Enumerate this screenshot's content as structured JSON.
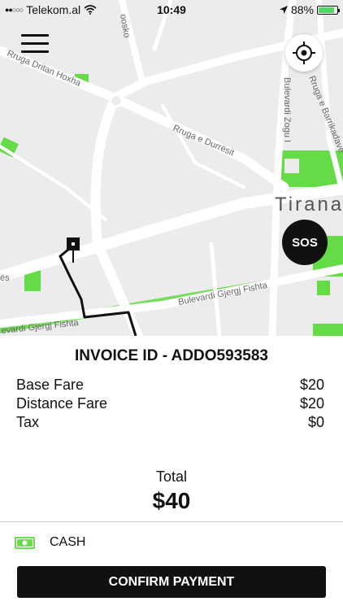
{
  "status_bar": {
    "carrier": "Telekom.al",
    "time": "10:49",
    "battery": "88%",
    "battery_level": 0.88
  },
  "map": {
    "streets": {
      "rruga_dritan_hoxha": "Rruga Dritan Hoxha",
      "rruga_e_durresit": "Rruga e Durrësit",
      "bulevardi_zogu": "Bulevardi Zogu I",
      "rruga_e_barrikadave": "Rruga e Barrikadave",
      "bulevardi_gjergj_fishta": "Bulevardi Gjergj Fishta",
      "bulevardi_gjergj_fishta_left": "evardi Gjergj Fishta",
      "osko": "oosko",
      "es": "ës"
    },
    "city": "Tirana",
    "sos_label": "SOS",
    "colors": {
      "route": "#111111",
      "park": "#64db47",
      "road": "#ffffff"
    }
  },
  "invoice": {
    "title": "INVOICE ID - ADDO593583",
    "fares": [
      {
        "label": "Base Fare",
        "amount": "$20"
      },
      {
        "label": "Distance Fare",
        "amount": "$20"
      },
      {
        "label": "Tax",
        "amount": "$0"
      }
    ],
    "total_label": "Total",
    "total_value": "$40"
  },
  "payment": {
    "method": "CASH",
    "icon": "cash-icon"
  },
  "confirm_button": "CONFIRM PAYMENT"
}
